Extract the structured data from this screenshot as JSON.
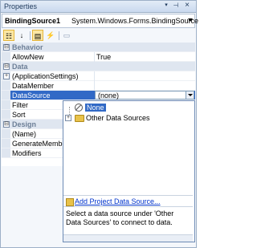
{
  "window": {
    "title": "Properties"
  },
  "selector": {
    "object_name": "BindingSource1",
    "object_type": "System.Windows.Forms.BindingSource"
  },
  "grid": {
    "rows": [
      {
        "kind": "category",
        "label": "Behavior",
        "box": "⊟"
      },
      {
        "kind": "prop",
        "label": "AllowNew",
        "value": "True"
      },
      {
        "kind": "category",
        "label": "Data",
        "box": "⊟"
      },
      {
        "kind": "prop",
        "label": "(ApplicationSettings)",
        "value": "",
        "expander": "+"
      },
      {
        "kind": "prop",
        "label": "DataMember",
        "value": ""
      },
      {
        "kind": "selected",
        "label": "DataSource",
        "value": "(none)"
      },
      {
        "kind": "prop",
        "label": "Filter",
        "value": ""
      },
      {
        "kind": "prop",
        "label": "Sort",
        "value": ""
      },
      {
        "kind": "category",
        "label": "Design",
        "box": "⊟"
      },
      {
        "kind": "prop",
        "label": "(Name)",
        "value": ""
      },
      {
        "kind": "prop",
        "label": "GenerateMember",
        "value": ""
      },
      {
        "kind": "prop",
        "label": "Modifiers",
        "value": ""
      }
    ]
  },
  "popup": {
    "tree": [
      {
        "label": "None",
        "selected": true
      },
      {
        "label": "Other Data Sources",
        "expander": "+"
      }
    ],
    "add_link": "Add Project Data Source...",
    "help_text": "Select a data source under 'Other Data Sources' to connect to data."
  },
  "colors": {
    "selection": "#3169c6",
    "category_bg": "#dfe6f0",
    "link": "#0033cc"
  }
}
